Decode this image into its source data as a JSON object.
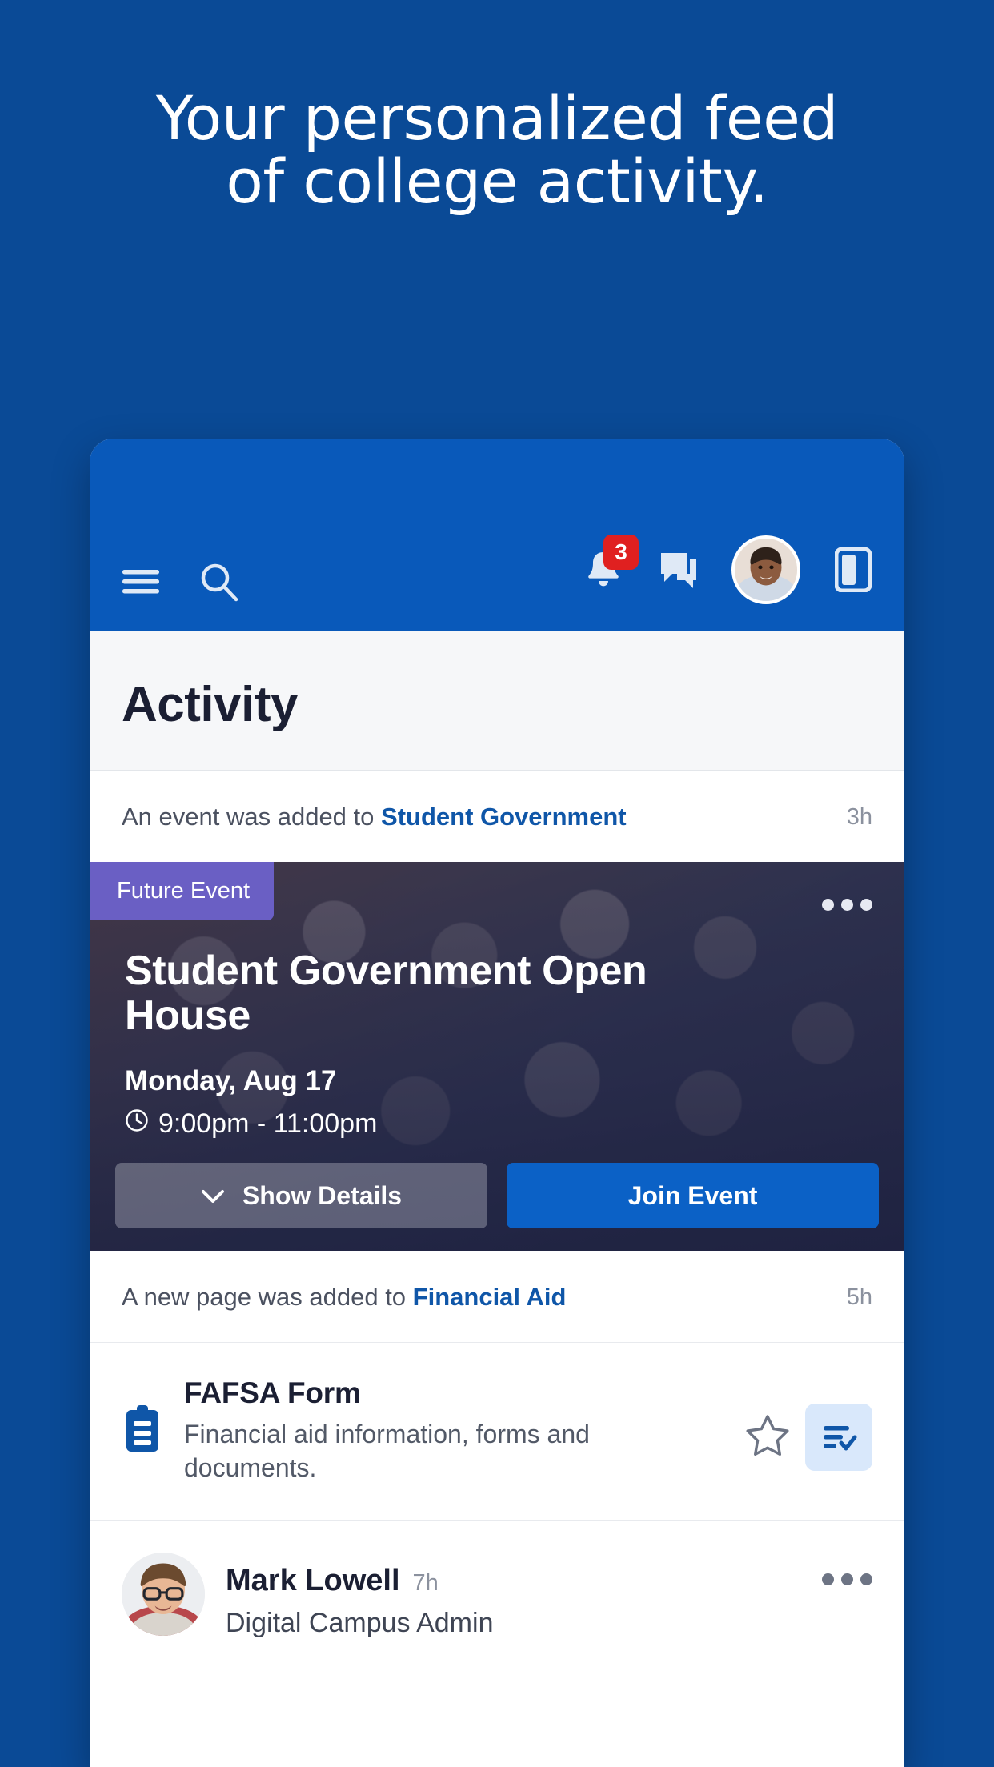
{
  "colors": {
    "page_background": "#0a4a96",
    "appbar": "#0959ba",
    "accent_link": "#0f56a8",
    "primary_button": "#0b61c6",
    "badge_red": "#e02020",
    "future_event_purple": "#6a5fc4",
    "action_tile": "#d9e8fb"
  },
  "headline": {
    "line1": "Your personalized feed",
    "line2": "of college activity."
  },
  "appbar": {
    "menu_icon": "hamburger-menu-icon",
    "search_icon": "search-icon",
    "notifications_icon": "bell-icon",
    "notifications_count": "3",
    "messages_icon": "chat-bubble-icon",
    "avatar_label": "user-avatar",
    "panel_icon": "side-panel-icon"
  },
  "section": {
    "title": "Activity"
  },
  "feed": [
    {
      "kind": "event-notice",
      "prefix": "An event was added to ",
      "target": "Student Government",
      "timestamp": "3h"
    },
    {
      "kind": "page-notice",
      "prefix": "A new page was added to ",
      "target": "Financial Aid",
      "timestamp": "5h"
    }
  ],
  "event_card": {
    "badge": "Future Event",
    "more_icon": "ellipsis-icon",
    "title": "Student Government Open House",
    "date": "Monday, Aug 17",
    "clock_icon": "clock-icon",
    "time": "9:00pm - 11:00pm",
    "show_details_label": "Show Details",
    "chevron_icon": "chevron-down-icon",
    "join_label": "Join Event"
  },
  "page_item": {
    "icon": "clipboard-icon",
    "title": "FAFSA Form",
    "description": "Financial aid information, forms and documents.",
    "star_icon": "star-outline-icon",
    "checklist_icon": "checklist-icon"
  },
  "post": {
    "avatar_label": "mark-lowell-avatar",
    "name": "Mark Lowell",
    "timestamp": "7h",
    "subtitle": "Digital Campus Admin",
    "more_icon": "ellipsis-icon"
  }
}
